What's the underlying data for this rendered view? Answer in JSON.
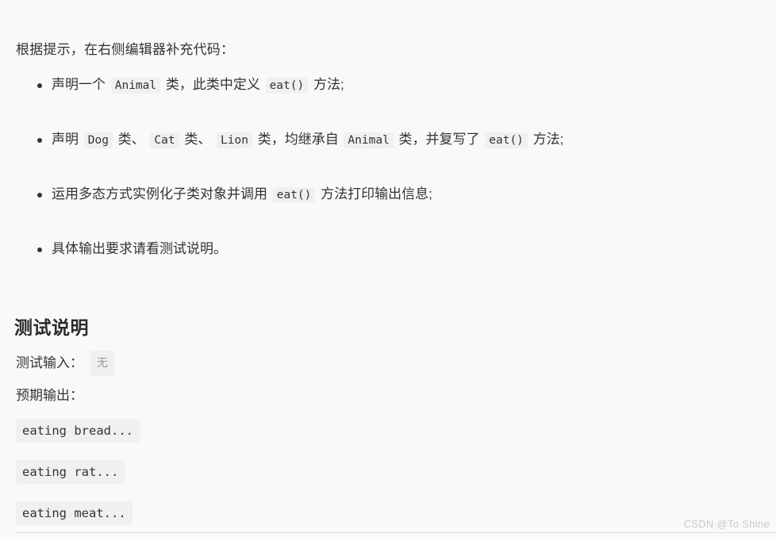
{
  "page": {
    "background_color": "#f9f9f9",
    "text_color": "#333333",
    "code_background_color": "#f0f0f0",
    "rule_color": "#dedede"
  },
  "intro": {
    "text": "根据提示，在右侧编辑器补充代码："
  },
  "requirements": {
    "items": [
      {
        "segments": [
          {
            "type": "text",
            "value": "声明一个 "
          },
          {
            "type": "code",
            "value": "Animal"
          },
          {
            "type": "text",
            "value": " 类，此类中定义 "
          },
          {
            "type": "code",
            "value": "eat()"
          },
          {
            "type": "text",
            "value": " 方法;"
          }
        ]
      },
      {
        "segments": [
          {
            "type": "text",
            "value": "声明 "
          },
          {
            "type": "code",
            "value": "Dog"
          },
          {
            "type": "text",
            "value": " 类、 "
          },
          {
            "type": "code",
            "value": "Cat"
          },
          {
            "type": "text",
            "value": " 类、 "
          },
          {
            "type": "code",
            "value": "Lion"
          },
          {
            "type": "text",
            "value": " 类，均继承自 "
          },
          {
            "type": "code",
            "value": "Animal"
          },
          {
            "type": "text",
            "value": " 类，并复写了 "
          },
          {
            "type": "code",
            "value": "eat()"
          },
          {
            "type": "text",
            "value": " 方法;"
          }
        ]
      },
      {
        "segments": [
          {
            "type": "text",
            "value": "运用多态方式实例化子类对象并调用 "
          },
          {
            "type": "code",
            "value": "eat()"
          },
          {
            "type": "text",
            "value": " 方法打印输出信息;"
          }
        ]
      },
      {
        "segments": [
          {
            "type": "text",
            "value": "具体输出要求请看测试说明。"
          }
        ]
      }
    ]
  },
  "test_section": {
    "heading": "测试说明",
    "input_label": "测试输入：",
    "input_value": "无",
    "expected_label": "预期输出：",
    "expected_outputs": [
      "eating bread...",
      "eating rat...",
      "eating meat..."
    ]
  },
  "watermark": {
    "text": "CSDN @To Shine"
  }
}
